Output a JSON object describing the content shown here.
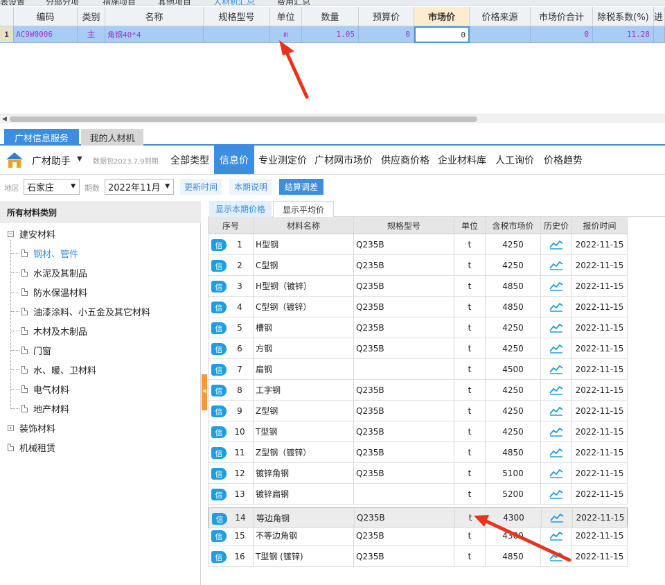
{
  "top_tabs": [
    "表设置",
    "分部分项",
    "措施项目",
    "其他项目",
    "人材机汇总",
    "费用汇总"
  ],
  "grid": {
    "columns": [
      "编码",
      "类别",
      "名称",
      "规格型号",
      "单位",
      "数量",
      "预算价",
      "市场价",
      "价格来源",
      "市场价合计",
      "除税系数(%)",
      "进"
    ],
    "row": {
      "index": "1",
      "code": "AC9W0006",
      "category": "主",
      "name": "角钢40*4",
      "spec": "",
      "unit": "m",
      "quantity": "1.05",
      "budget_price": "0",
      "market_price": "0",
      "price_source": "",
      "market_total": "0",
      "tax_coef": "11.28"
    }
  },
  "service_tabs": {
    "active": "广材信息服务",
    "other": "我的人材机"
  },
  "toolbar": {
    "brand": "广材助手",
    "package": "数据包2023.7.9到期",
    "nav": [
      "全部类型",
      "信息价",
      "专业测定价",
      "广材网市场价",
      "供应商价格",
      "企业材料库",
      "人工询价",
      "价格趋势"
    ],
    "active_nav": "信息价"
  },
  "filters": {
    "region_label": "地区",
    "region_value": "石家庄",
    "period_label": "期数",
    "period_value": "2022年11月",
    "update_time": "更新时间",
    "period_note": "本期说明",
    "settle_adjust": "结算调差"
  },
  "tree": {
    "header": "所有材料类别",
    "root": "建安材料",
    "children": [
      "钢材、管件",
      "水泥及其制品",
      "防水保温材料",
      "油漆涂料、小五金及其它材料",
      "木材及木制品",
      "门窗",
      "水、暖、卫材料",
      "电气材料",
      "地产材料"
    ],
    "active_child": "钢材、管件",
    "others": [
      "装饰材料",
      "机械租赁"
    ]
  },
  "price_tabs": {
    "active": "显示本期价格",
    "other": "显示平均价"
  },
  "price_table": {
    "badge": "信",
    "columns": [
      "序号",
      "材料名称",
      "规格型号",
      "单位",
      "含税市场价",
      "历史价",
      "报价时间"
    ],
    "rows": [
      {
        "no": "1",
        "name": "H型钢",
        "spec": "Q235B",
        "unit": "t",
        "price": "4250",
        "date": "2022-11-15"
      },
      {
        "no": "2",
        "name": "C型钢",
        "spec": "Q235B",
        "unit": "t",
        "price": "4250",
        "date": "2022-11-15"
      },
      {
        "no": "3",
        "name": "H型钢（镀锌）",
        "spec": "Q235B",
        "unit": "t",
        "price": "4850",
        "date": "2022-11-15"
      },
      {
        "no": "4",
        "name": "C型钢（镀锌）",
        "spec": "Q235B",
        "unit": "t",
        "price": "4850",
        "date": "2022-11-15"
      },
      {
        "no": "5",
        "name": "槽钢",
        "spec": "Q235B",
        "unit": "t",
        "price": "4250",
        "date": "2022-11-15"
      },
      {
        "no": "6",
        "name": "方钢",
        "spec": "Q235B",
        "unit": "t",
        "price": "4250",
        "date": "2022-11-15"
      },
      {
        "no": "7",
        "name": "扁钢",
        "spec": "",
        "unit": "t",
        "price": "4500",
        "date": "2022-11-15"
      },
      {
        "no": "8",
        "name": "工字钢",
        "spec": "Q235B",
        "unit": "t",
        "price": "4250",
        "date": "2022-11-15"
      },
      {
        "no": "9",
        "name": "Z型钢",
        "spec": "Q235B",
        "unit": "t",
        "price": "4250",
        "date": "2022-11-15"
      },
      {
        "no": "10",
        "name": "T型钢",
        "spec": "Q235B",
        "unit": "t",
        "price": "4250",
        "date": "2022-11-15"
      },
      {
        "no": "11",
        "name": "Z型钢（镀锌）",
        "spec": "Q235B",
        "unit": "t",
        "price": "4850",
        "date": "2022-11-15"
      },
      {
        "no": "12",
        "name": "镀锌角钢",
        "spec": "Q235B",
        "unit": "t",
        "price": "5100",
        "date": "2022-11-15"
      },
      {
        "no": "13",
        "name": "镀锌扁钢",
        "spec": "",
        "unit": "t",
        "price": "5200",
        "date": "2022-11-15"
      },
      {
        "no": "14",
        "name": "等边角钢",
        "spec": "Q235B",
        "unit": "t",
        "price": "4300",
        "date": "2022-11-15"
      },
      {
        "no": "15",
        "name": "不等边角钢",
        "spec": "Q235B",
        "unit": "t",
        "price": "4300",
        "date": "2022-11-15"
      },
      {
        "no": "16",
        "name": "T型钢 (镀锌)",
        "spec": "Q235B",
        "unit": "t",
        "price": "4850",
        "date": "2022-11-15"
      }
    ],
    "selected_row": "14"
  },
  "colors": {
    "accent": "#3d8ede",
    "arrow": "#e8341c",
    "badge": "#1f9de0",
    "splitter": "#f39a3b",
    "row_selected": "#a9ccf4"
  },
  "icons": {
    "trend": "line-chart-icon",
    "logo": "guangcai-logo-icon",
    "dropdown": "caret-down-icon"
  }
}
